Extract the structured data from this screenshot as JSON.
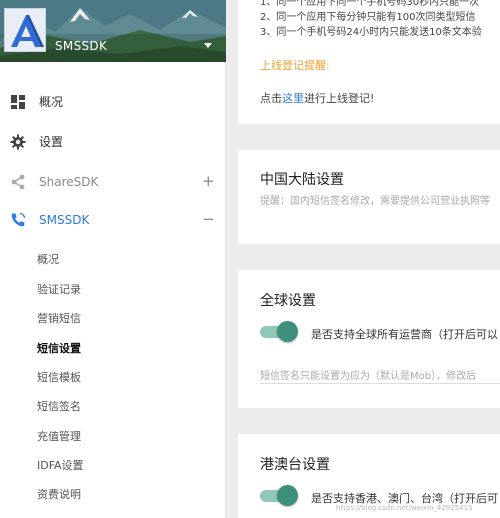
{
  "sidebar": {
    "brand": "SMSSDK",
    "nav": [
      {
        "label": "概况"
      },
      {
        "label": "设置"
      },
      {
        "label": "ShareSDK",
        "toggle": "+"
      },
      {
        "label": "SMSSDK",
        "toggle": "−"
      }
    ],
    "sub_items": [
      "概况",
      "验证记录",
      "营销短信",
      "短信设置",
      "短信模板",
      "短信签名",
      "充值管理",
      "IDFA设置",
      "资费说明"
    ],
    "current_sub_item": "短信设置"
  },
  "rules_card": {
    "lines": [
      "1、同一个应用下同一个手机号码30秒内只能一次",
      "2、同一个应用下每分钟只能有100次同类型短信",
      "3、同一个手机号码24小时内只能发送10条文本验"
    ],
    "warning_link": "上线登记提醒:",
    "online_prefix": "点击",
    "online_link": "这里",
    "online_suffix": "进行上线登记!"
  },
  "mainland_card": {
    "title": "中国大陆设置",
    "hint": "提醒：国内短信签名修改，需要提供公司营业执照等"
  },
  "global_card": {
    "title": "全球设置",
    "toggle_label": "是否支持全球所有运营商（打开后可以",
    "toggle_on": true,
    "signature_placeholder": "短信签名只能设置为应为（默认是Mob），修改后"
  },
  "hmt_card": {
    "title": "港澳台设置",
    "toggle_label": "是否支持香港、澳门、台湾（打开后可",
    "toggle_on": true
  },
  "watermark": "https://blog.csdn.net/weixin_42925415",
  "colors": {
    "accent_blue": "#2a7ae2",
    "warning_orange": "#f0a030",
    "toggle_green": "#3e8f7c"
  }
}
